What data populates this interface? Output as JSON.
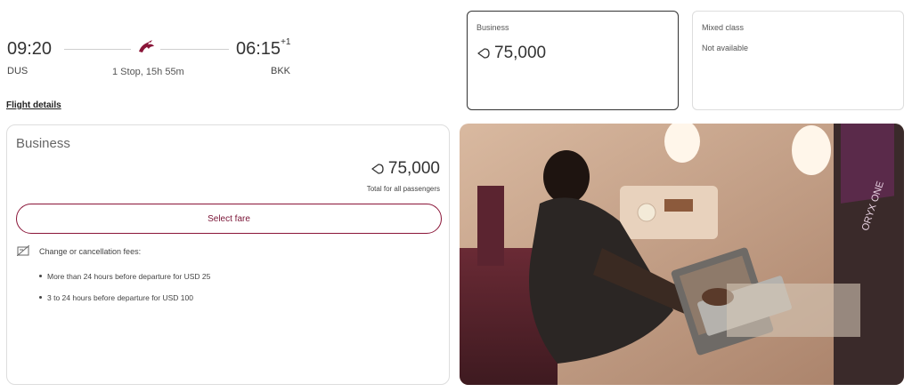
{
  "flight": {
    "departure_time": "09:20",
    "departure_code": "DUS",
    "arrival_time": "06:15",
    "arrival_day_offset": "+1",
    "arrival_code": "BKK",
    "stops": "1 Stop, 15h 55m",
    "details_link": "Flight details",
    "airline_logo": "oryx-logo-icon"
  },
  "fare_cards": [
    {
      "title": "Business",
      "price": "75,000",
      "selected": true
    },
    {
      "title": "Mixed class",
      "status": "Not available"
    }
  ],
  "detail": {
    "title": "Business",
    "price": "75,000",
    "price_note": "Total for all passengers",
    "select_label": "Select fare",
    "fees_heading": "Change or cancellation fees:",
    "fees": [
      "More than 24 hours before departure for USD 25",
      "3 to 24 hours before departure for USD 100"
    ]
  },
  "photo": {
    "subject": "passenger-working-on-laptop-business-suite",
    "screen_text": "ORYX ONE"
  },
  "colors": {
    "brand": "#8a1538",
    "text": "#333333",
    "border": "#dddddd"
  }
}
